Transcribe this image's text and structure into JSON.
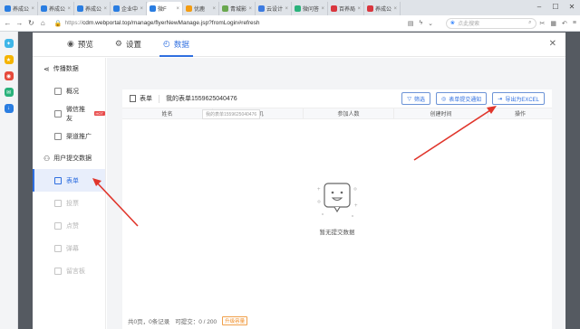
{
  "browser": {
    "tabs": [
      {
        "label": "养成公",
        "color": "#2a7de1",
        "active": false
      },
      {
        "label": "养成公",
        "color": "#2a7de1",
        "active": false
      },
      {
        "label": "养成公",
        "color": "#2a7de1",
        "active": false
      },
      {
        "label": "企业中",
        "color": "#2a7de1",
        "active": false
      },
      {
        "label": "微F",
        "color": "#2a7de1",
        "active": true
      },
      {
        "label": "优鹿",
        "color": "#f39c12",
        "active": false
      },
      {
        "label": "青城影",
        "color": "#6aa84f",
        "active": false
      },
      {
        "label": "云设计",
        "color": "#3d7be0",
        "active": false
      },
      {
        "label": "微问答",
        "color": "#2ab27b",
        "active": false
      },
      {
        "label": "百养局",
        "color": "#d9363e",
        "active": false
      },
      {
        "label": "养成公",
        "color": "#d9363e",
        "active": false
      }
    ],
    "url_scheme": "https://",
    "url_rest": "cdm.webportal.top/manage/flyerNewManage.jsp?fromLogin#refresh",
    "search_placeholder": "点此搜索"
  },
  "modal": {
    "tabs": [
      {
        "label": "预览",
        "icon": "eye-icon",
        "glyph": "◉",
        "active": false
      },
      {
        "label": "设置",
        "icon": "gear-icon",
        "glyph": "⚙",
        "active": false
      },
      {
        "label": "数据",
        "icon": "chart-icon",
        "glyph": "◴",
        "active": true
      }
    ],
    "close_glyph": "✕"
  },
  "sidebar": {
    "group1": "传播数据",
    "overview": "概况",
    "wechat_promo": "微信推友",
    "hot_badge": "HOT",
    "channel_promo": "渠道推广",
    "group2": "用户提交数据",
    "form": "表单",
    "vote": "投票",
    "like": "点赞",
    "danmaku": "弹幕",
    "guestbook": "留言板"
  },
  "panel": {
    "form_label": "表单",
    "form_name": "我的表单1559625040476",
    "tooltip": "我的表单1559625040476",
    "filter_btn": "筛选",
    "notify_btn": "表单提交通知",
    "export_btn": "导出为EXCEL",
    "columns": [
      "姓名",
      "手机",
      "参加人数",
      "创建时间",
      "操作"
    ],
    "empty_text": "暂无提交数据",
    "footer_pages": "共0页，0条记录",
    "footer_quota": "可提交：0 / 200",
    "upgrade": "升级容量"
  },
  "colors": {
    "accent": "#2f6fe0",
    "arrow": "#e0352b"
  }
}
